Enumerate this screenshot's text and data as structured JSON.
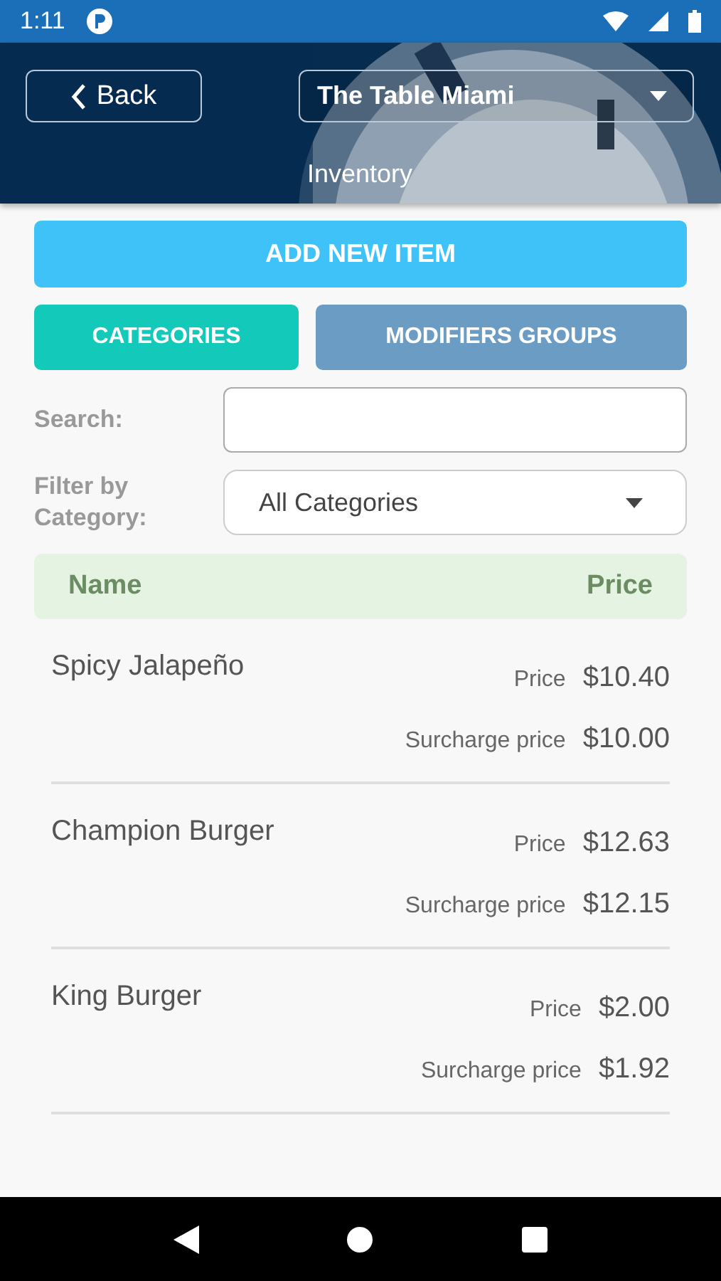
{
  "status_bar": {
    "time": "1:11"
  },
  "header": {
    "back": "Back",
    "venue": "The Table Miami",
    "title": "Inventory"
  },
  "add_button": "ADD NEW ITEM",
  "tabs": [
    {
      "label": "CATEGORIES",
      "selected": true
    },
    {
      "label": "MODIFIERS GROUPS",
      "selected": false
    }
  ],
  "search": {
    "label": "Search:"
  },
  "filter": {
    "label": "Filter by Category:",
    "value": "All Categories"
  },
  "table": {
    "columns": [
      "Name",
      "Price"
    ],
    "rows": [
      {
        "name": "Spicy Jalapeño",
        "price_label": "Price",
        "price": "$10.40",
        "surcharge_label": "Surcharge price",
        "surcharge": "$10.00"
      },
      {
        "name": "Champion Burger",
        "price_label": "Price",
        "price": "$12.63",
        "surcharge_label": "Surcharge price",
        "surcharge": "$12.15"
      },
      {
        "name": "King Burger",
        "price_label": "Price",
        "price": "$2.00",
        "surcharge_label": "Surcharge price",
        "surcharge": "$1.92"
      }
    ]
  }
}
